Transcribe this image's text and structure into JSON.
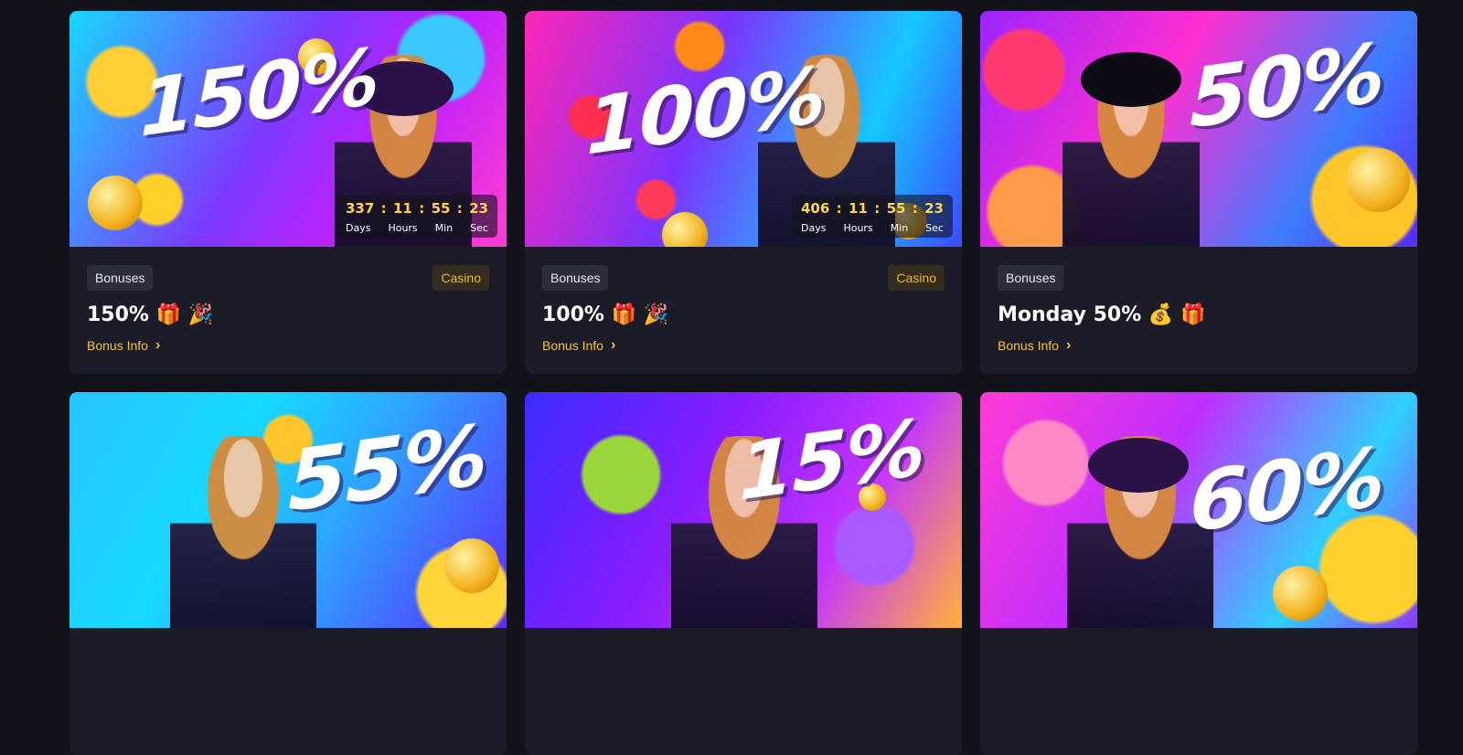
{
  "cards": [
    {
      "banner_percent": "150%",
      "timer": {
        "days": "337",
        "hours": "11",
        "min": "55",
        "sec": "23"
      },
      "tag": "Bonuses",
      "badge": "Casino",
      "title": "150% 🎁 🎉",
      "link": "Bonus Info"
    },
    {
      "banner_percent": "100%",
      "timer": {
        "days": "406",
        "hours": "11",
        "min": "55",
        "sec": "23"
      },
      "tag": "Bonuses",
      "badge": "Casino",
      "title": "100% 🎁 🎉",
      "link": "Bonus Info"
    },
    {
      "banner_percent": "50%",
      "tag": "Bonuses",
      "title": "Monday 50% 💰 🎁",
      "link": "Bonus Info"
    },
    {
      "banner_percent": "55%"
    },
    {
      "banner_percent": "15%"
    },
    {
      "banner_percent": "60%"
    }
  ],
  "timer_labels": {
    "days": "Days",
    "hours": "Hours",
    "min": "Min",
    "sec": "Sec"
  },
  "separator": ":",
  "chevron": "›",
  "colors": {
    "page_bg": "#11121a",
    "card_bg": "#1b1c27",
    "accent": "#f0c540",
    "timer_digits": "#ffd34d"
  }
}
